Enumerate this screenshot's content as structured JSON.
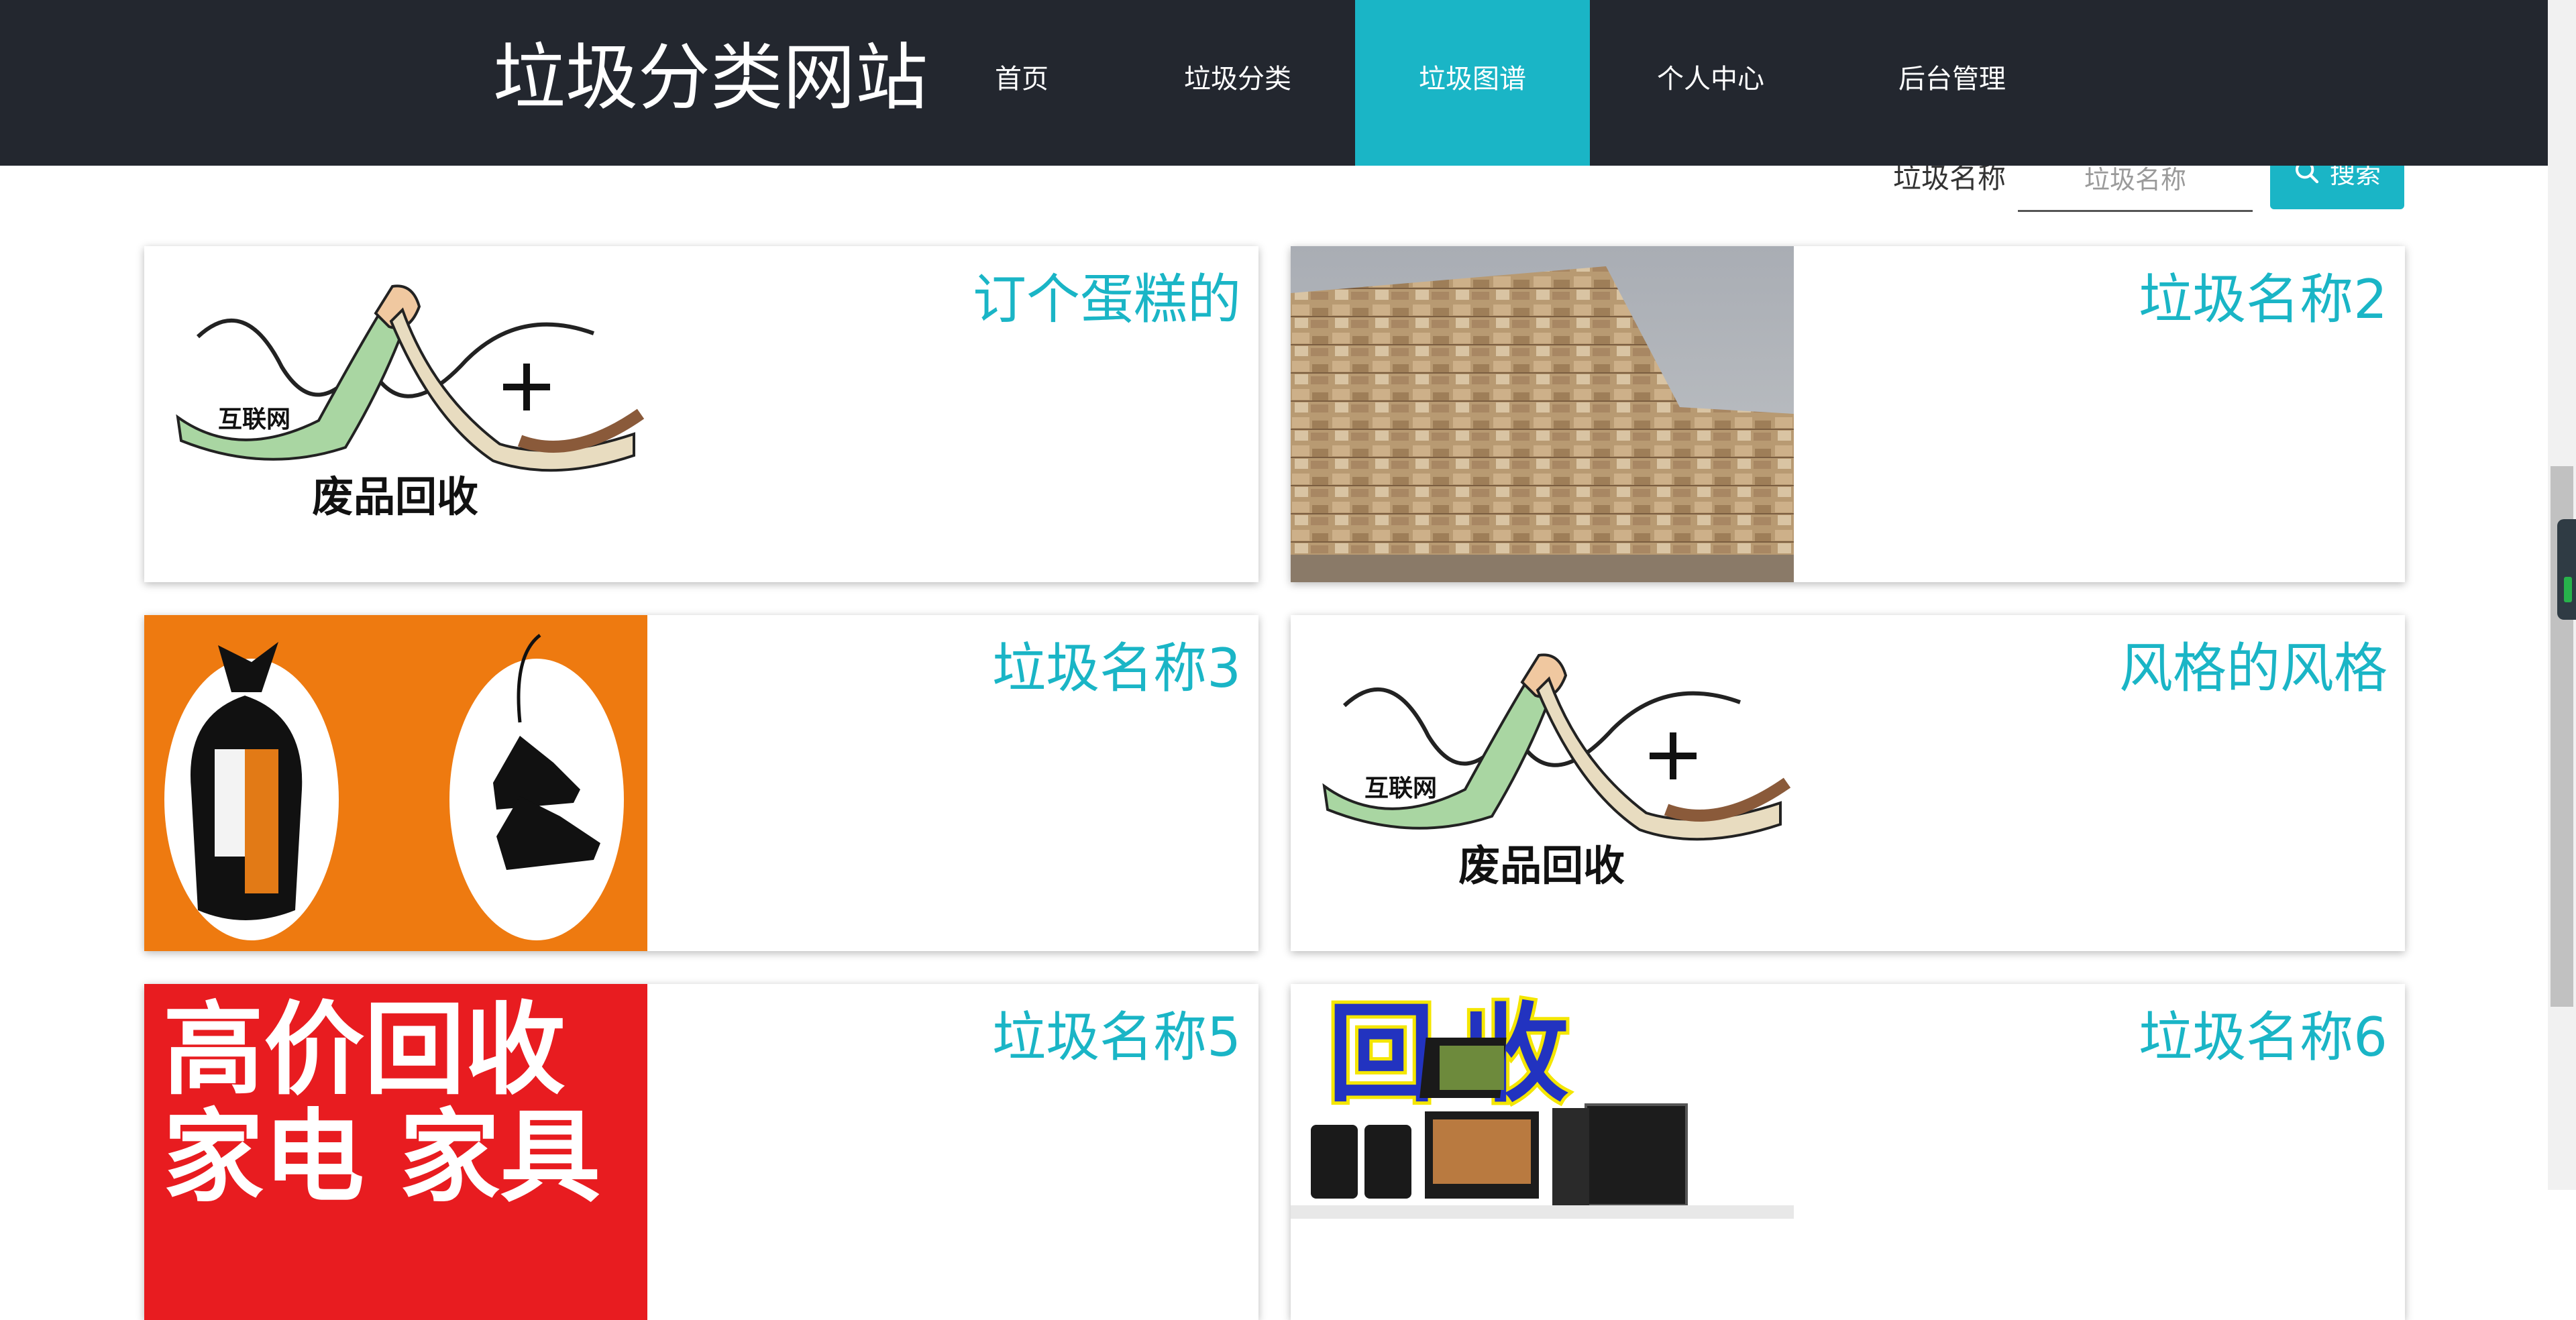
{
  "site": {
    "title": "垃圾分类网站"
  },
  "nav": {
    "items": [
      {
        "label": "首页"
      },
      {
        "label": "垃圾分类"
      },
      {
        "label": "垃圾图谱",
        "active": true
      },
      {
        "label": "个人中心"
      },
      {
        "label": "后台管理"
      }
    ]
  },
  "search": {
    "label": "垃圾名称",
    "placeholder": "垃圾名称",
    "value": "",
    "button_label": "搜索",
    "button_icon": "search-icon"
  },
  "cards": [
    {
      "title": "订个蛋糕的",
      "image": "recycling-handshake-logo",
      "image_text": [
        "互联网",
        "废品回收"
      ]
    },
    {
      "title": "垃圾名称2",
      "image": "baled-cardboard-photo"
    },
    {
      "title": "垃圾名称3",
      "image": "clothes-and-shoes-donation"
    },
    {
      "title": "风格的风格",
      "image": "recycling-handshake-logo",
      "image_text": [
        "互联网",
        "废品回收"
      ]
    },
    {
      "title": "垃圾名称5",
      "image": "high-price-recycling-banner",
      "image_text": [
        "高价回收",
        "家电 家具"
      ]
    },
    {
      "title": "垃圾名称6",
      "image": "electronics-recycling-banner",
      "image_text": [
        "回收"
      ]
    }
  ],
  "colors": {
    "header_bg": "#23272f",
    "accent": "#1ab5c6",
    "orange": "#ee7a10",
    "red": "#e81c20"
  }
}
